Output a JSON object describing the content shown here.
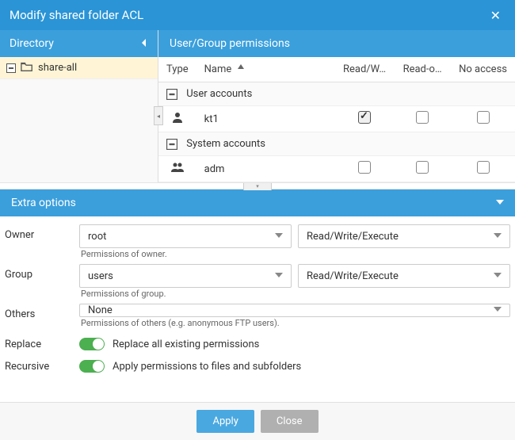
{
  "title": "Modify shared folder ACL",
  "directory": {
    "header": "Directory",
    "items": [
      {
        "label": "share-all"
      }
    ]
  },
  "permissions": {
    "header": "User/Group permissions",
    "columns": {
      "type": "Type",
      "name": "Name",
      "readwrite": "Read/W…",
      "readonly": "Read-o…",
      "noaccess": "No access"
    },
    "groups": [
      {
        "label": "User accounts",
        "rows": [
          {
            "name": "kt1",
            "rw": true,
            "ro": false,
            "na": false,
            "icon": "person"
          }
        ]
      },
      {
        "label": "System accounts",
        "rows": [
          {
            "name": "adm",
            "rw": false,
            "ro": false,
            "na": false,
            "icon": "group"
          }
        ]
      }
    ]
  },
  "extra": {
    "header": "Extra options",
    "owner": {
      "label": "Owner",
      "value": "root",
      "perm": "Read/Write/Execute",
      "helper": "Permissions of owner."
    },
    "group": {
      "label": "Group",
      "value": "users",
      "perm": "Read/Write/Execute",
      "helper": "Permissions of group."
    },
    "others": {
      "label": "Others",
      "value": "None",
      "helper": "Permissions of others (e.g. anonymous FTP users)."
    },
    "replace": {
      "label": "Replace",
      "text": "Replace all existing permissions",
      "on": true
    },
    "recursive": {
      "label": "Recursive",
      "text": "Apply permissions to files and subfolders",
      "on": true
    }
  },
  "footer": {
    "apply": "Apply",
    "close": "Close"
  }
}
